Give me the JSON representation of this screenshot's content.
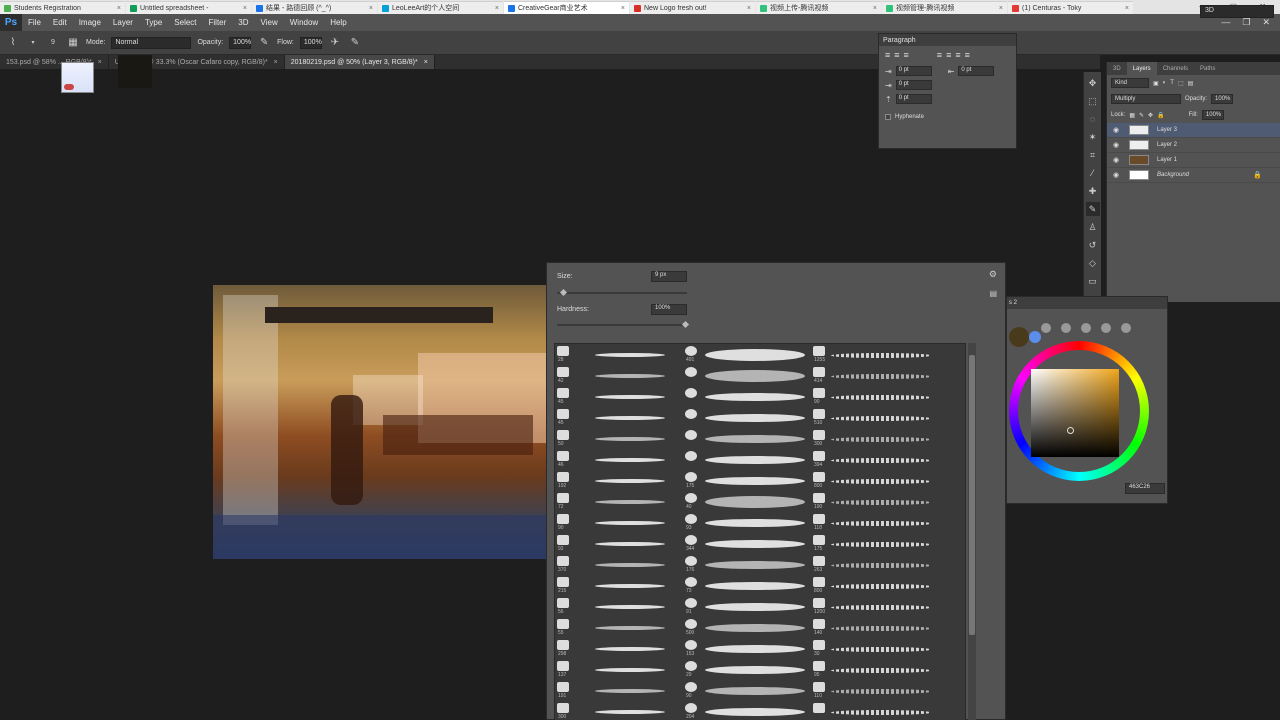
{
  "browser": {
    "tabs": [
      {
        "label": "Students Registration",
        "color": "#4caf50",
        "active": false
      },
      {
        "label": "Untitled spreadsheet -",
        "color": "#0f9d58",
        "active": false
      },
      {
        "label": "结果 - 路德回顾 (^_^)",
        "color": "#1a73e8",
        "active": false
      },
      {
        "label": "LeoLeeArt的个人空间",
        "color": "#00a1d6",
        "active": false
      },
      {
        "label": "CreativeGear商业艺术",
        "color": "#1a73e8",
        "active": true
      },
      {
        "label": "New Logo fresh out!",
        "color": "#d93025",
        "active": false
      },
      {
        "label": "视频上传-腾讯视频",
        "color": "#31c27c",
        "active": false
      },
      {
        "label": "视频管理-腾讯视频",
        "color": "#31c27c",
        "active": false
      },
      {
        "label": "(1) Centuras - Toky",
        "color": "#e53935",
        "active": false
      }
    ]
  },
  "menu": [
    "File",
    "Edit",
    "Image",
    "Layer",
    "Type",
    "Select",
    "Filter",
    "3D",
    "View",
    "Window",
    "Help"
  ],
  "options": {
    "size_value": "9",
    "mode_label": "Mode:",
    "mode_value": "Normal",
    "opacity_label": "Opacity:",
    "opacity_value": "100%",
    "flow_label": "Flow:",
    "flow_value": "100%",
    "workspace": "3D"
  },
  "doc_tabs": [
    {
      "label": "153.psd @ 58% ... RGB/8)*",
      "active": false
    },
    {
      "label": "Untitled-1 @ 33.3% (Oscar Cafaro copy, RGB/8)*",
      "active": false
    },
    {
      "label": "20180219.psd @ 50% (Layer 3, RGB/8)*",
      "active": true
    }
  ],
  "paragraph": {
    "title": "Paragraph",
    "indent_left": "0 pt",
    "indent_right": "0 pt",
    "indent_first": "0 pt",
    "space_before": "0 pt",
    "hyphenate": "Hyphenate"
  },
  "layers_panel": {
    "tabs": [
      "3D",
      "Layers",
      "Channels",
      "Paths"
    ],
    "kind": "Kind",
    "blend": "Multiply",
    "opacity_label": "Opacity:",
    "opacity_value": "100%",
    "lock_label": "Lock:",
    "fill_label": "Fill:",
    "fill_value": "100%",
    "layers": [
      {
        "name": "Layer 3",
        "selected": true
      },
      {
        "name": "Layer 2",
        "selected": false
      },
      {
        "name": "Layer 1",
        "selected": false
      },
      {
        "name": "Background",
        "selected": false
      }
    ]
  },
  "brush_picker": {
    "size_label": "Size:",
    "size_value": "9 px",
    "hardness_label": "Hardness:",
    "hardness_value": "100%",
    "col1_sizes": [
      "28",
      "42",
      "45",
      "45",
      "50",
      "46",
      "192",
      "72",
      "90",
      "92",
      "370",
      "215",
      "56",
      "55",
      "298",
      "137",
      "191",
      "300"
    ],
    "col2_sizes": [
      "491",
      "",
      "",
      "",
      "",
      "",
      "175",
      "40",
      "93",
      "344",
      "176",
      "73",
      "91",
      "500",
      "153",
      "29",
      "90",
      "204"
    ],
    "col3_sizes": [
      "1255",
      "414",
      "90",
      "510",
      "300",
      "394",
      "800",
      "190",
      "118",
      "175",
      "263",
      "800",
      "1200",
      "140",
      "30",
      "95",
      "110",
      ""
    ]
  },
  "color_panel": {
    "hex": "463C26"
  }
}
